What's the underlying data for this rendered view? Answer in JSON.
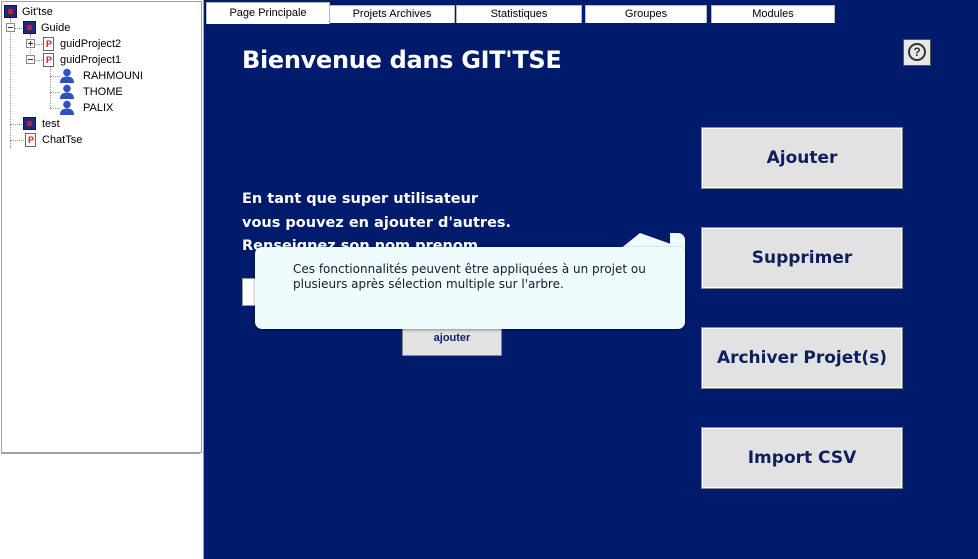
{
  "tree": {
    "root": "Git'tse",
    "guide": "Guide",
    "project2": "guidProject2",
    "project1": "guidProject1",
    "members": [
      "RAHMOUNI",
      "THOME",
      "PALIX"
    ],
    "test": "test",
    "chat": "ChatTse"
  },
  "tabs": [
    {
      "label": "Page Principale",
      "active": true
    },
    {
      "label": "Projets Archives",
      "active": false
    },
    {
      "label": "Statistiques",
      "active": false
    },
    {
      "label": "Groupes",
      "active": false
    },
    {
      "label": "Modules",
      "active": false
    }
  ],
  "main": {
    "title": "Bienvenue dans GIT'TSE",
    "help": "?",
    "intro_lines": [
      "En tant que super utilisateur",
      "vous pouvez en ajouter d'autres.",
      "Renseignez son nom prenom"
    ],
    "add_small": "ajouter",
    "buttons": [
      "Ajouter",
      "Supprimer",
      "Archiver Projet(s)",
      "Import CSV"
    ]
  },
  "tooltip": {
    "text": "Ces fonctionnalités peuvent être appliquées à un projet ou plusieurs après sélection multiple  sur l'arbre."
  },
  "colors": {
    "main_bg": "#001b6b",
    "button_text": "#0d1f5e",
    "tooltip_bg": "#effcfd"
  }
}
